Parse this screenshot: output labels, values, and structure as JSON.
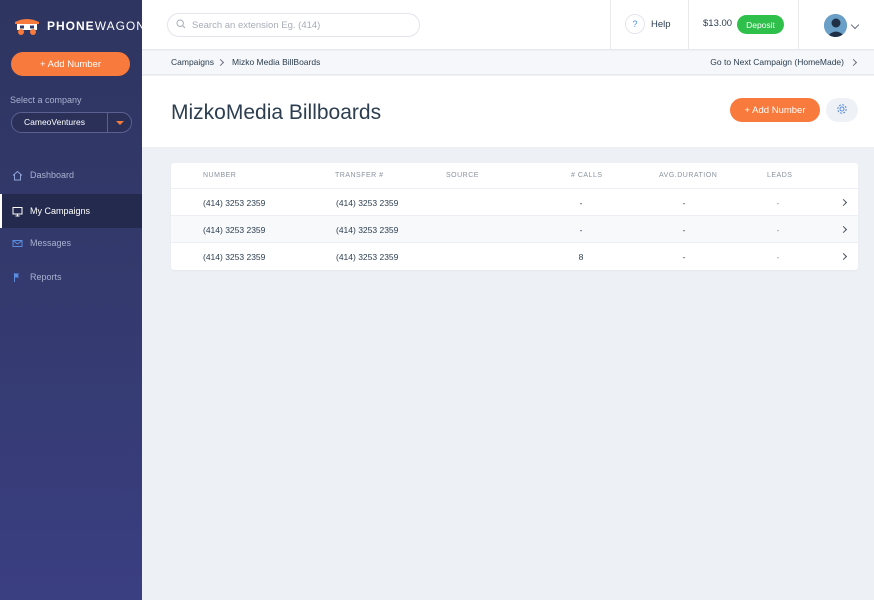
{
  "brand": {
    "name_bold": "PHONE",
    "name_thin": "WAGON"
  },
  "sidebar": {
    "add_number_label": "+ Add Number",
    "select_company_label": "Select a company",
    "company_value": "CameoVentures",
    "items": [
      {
        "label": "Dashboard",
        "icon": "home-icon",
        "active": false
      },
      {
        "label": "My Campaigns",
        "icon": "monitor-icon",
        "active": true
      },
      {
        "label": "Messages",
        "icon": "envelope-icon",
        "active": false
      },
      {
        "label": "Reports",
        "icon": "flag-icon",
        "active": false
      }
    ]
  },
  "topbar": {
    "search_placeholder": "Search an extension Eg. (414)",
    "help_icon_glyph": "?",
    "help_label": "Help",
    "balance": "$13.00",
    "deposit_label": "Deposit"
  },
  "breadcrumb": {
    "root": "Campaigns",
    "current": "Mizko Media BillBoards",
    "next_campaign": "Go to Next Campaign (HomeMade)"
  },
  "header": {
    "title": "MizkoMedia Billboards",
    "add_number_label": "+ Add Number"
  },
  "table": {
    "columns": [
      "NUMBER",
      "TRANSFER #",
      "SOURCE",
      "# CALLS",
      "AVG.DURATION",
      "LEADS"
    ],
    "rows": [
      {
        "number": "(414) 3253 2359",
        "transfer": "(414) 3253 2359",
        "source": "",
        "calls": "-",
        "avg_duration": "-",
        "leads": "-"
      },
      {
        "number": "(414) 3253 2359",
        "transfer": "(414) 3253 2359",
        "source": "",
        "calls": "-",
        "avg_duration": "-",
        "leads": "-"
      },
      {
        "number": "(414) 3253 2359",
        "transfer": "(414) 3253 2359",
        "source": "",
        "calls": "8",
        "avg_duration": "-",
        "leads": "-"
      }
    ]
  },
  "colors": {
    "accent": "#f97a3d",
    "deposit": "#2ec04a",
    "sidebar": "#343a6e",
    "text": "#2c3e50"
  }
}
